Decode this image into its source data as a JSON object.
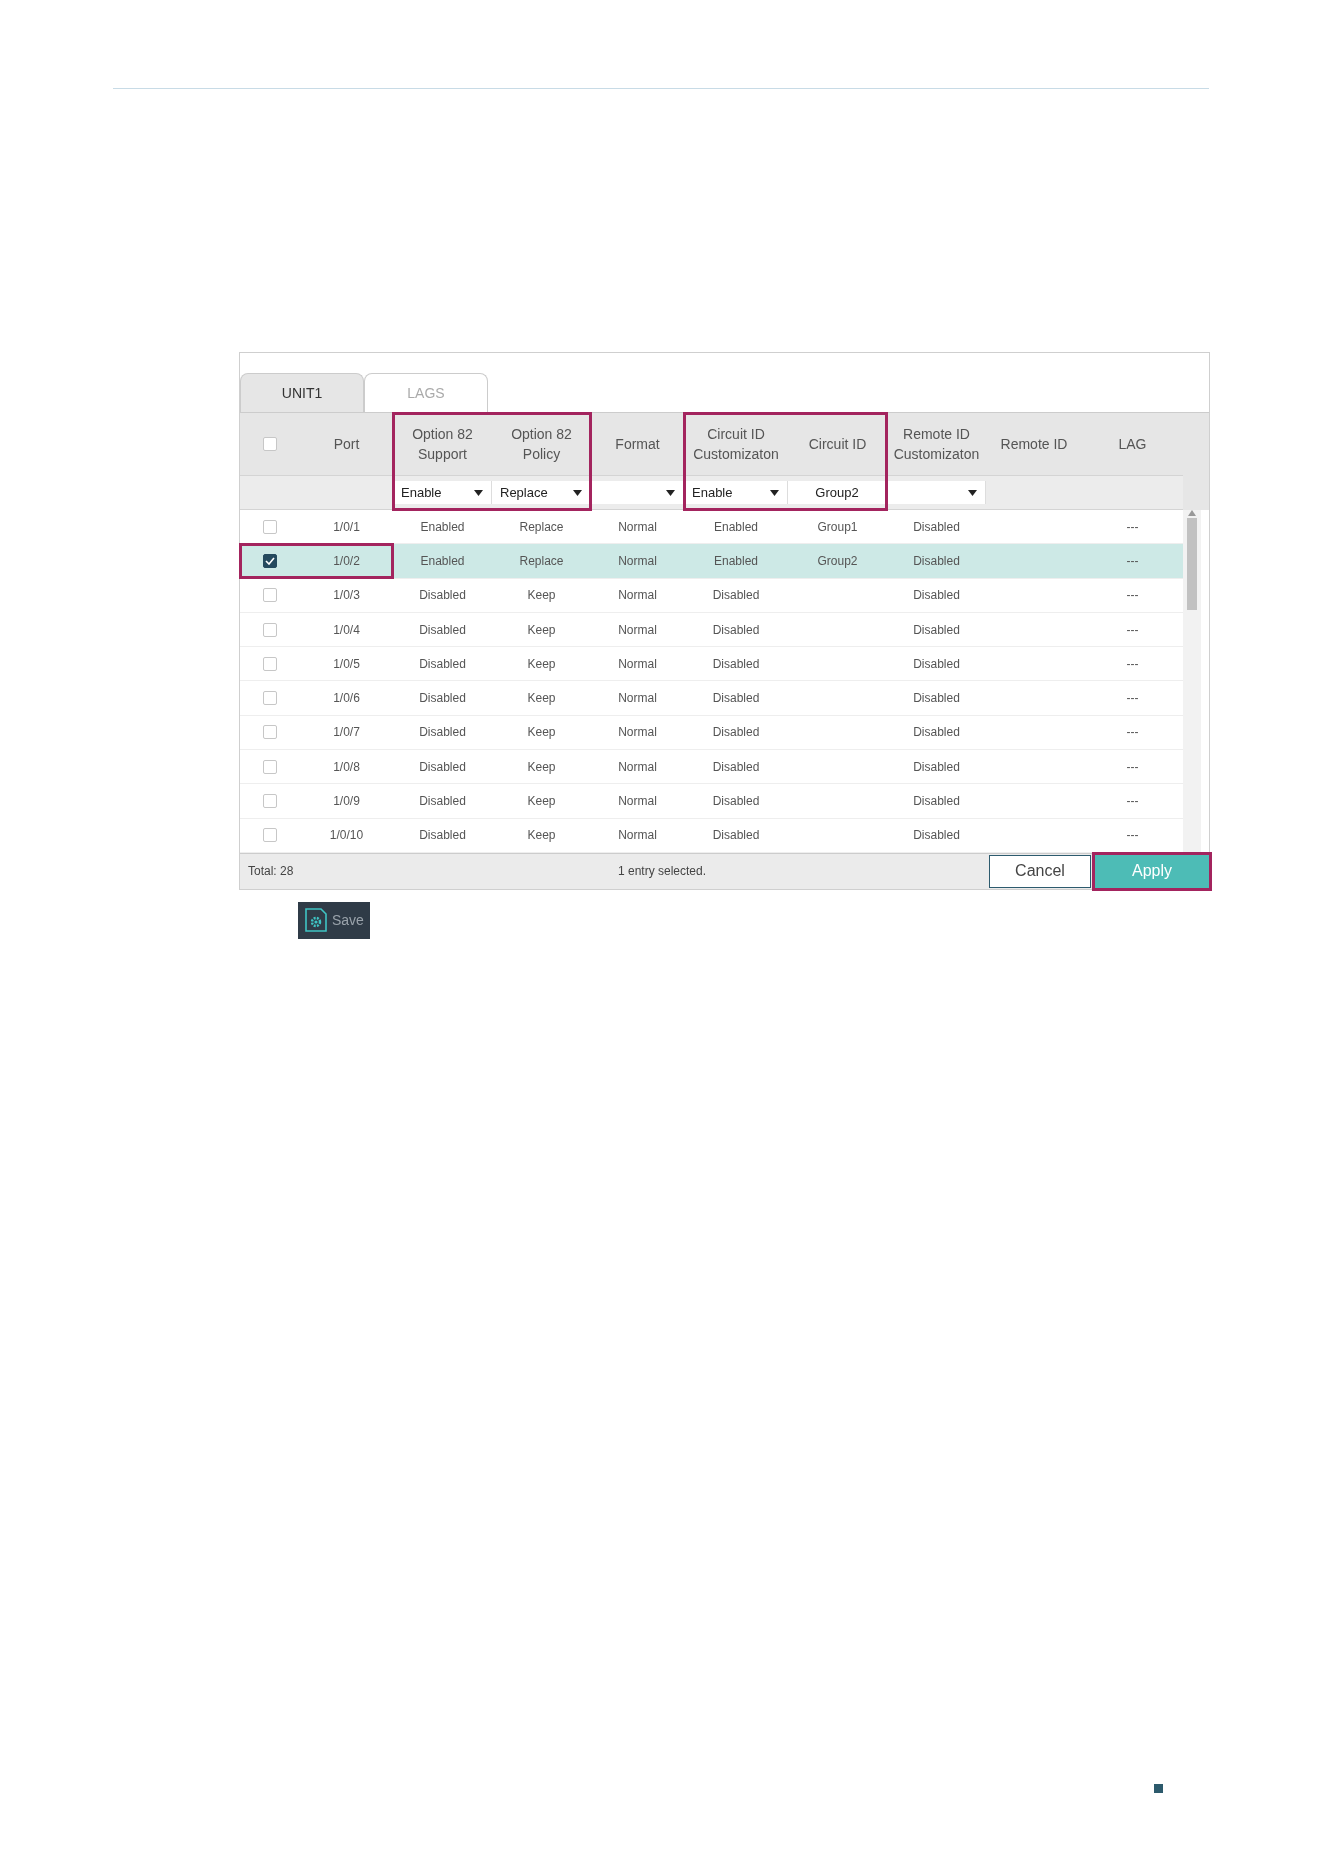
{
  "tabs": [
    {
      "label": "UNIT1",
      "selected": true
    },
    {
      "label": "LAGS",
      "selected": false
    }
  ],
  "table": {
    "select_all": {
      "checked": false
    },
    "column_groups": [
      {
        "highlighted": false,
        "columns": [
          {
            "label": "Port",
            "filter": {
              "kind": "none"
            }
          }
        ]
      },
      {
        "highlighted": true,
        "columns": [
          {
            "label": "Option 82 Support",
            "filter": {
              "kind": "select",
              "value": "Enable"
            }
          },
          {
            "label": "Option 82 Policy",
            "filter": {
              "kind": "select",
              "value": "Replace"
            }
          }
        ]
      },
      {
        "highlighted": false,
        "columns": [
          {
            "label": "Format",
            "filter": {
              "kind": "select"
            }
          }
        ]
      },
      {
        "highlighted": true,
        "columns": [
          {
            "label": "Circuit ID Customizaton",
            "filter": {
              "kind": "select",
              "value": "Enable"
            }
          },
          {
            "label": "Circuit ID",
            "filter": {
              "kind": "input",
              "value": "Group2"
            }
          }
        ]
      },
      {
        "highlighted": false,
        "columns": [
          {
            "label": "Remote ID Customizaton",
            "filter": {
              "kind": "select"
            }
          },
          {
            "label": "Remote ID",
            "filter": {
              "kind": "none"
            }
          },
          {
            "label": "LAG",
            "filter": {
              "kind": "none"
            }
          }
        ]
      }
    ],
    "rows": [
      {
        "checked": false,
        "selected": false,
        "highlighted": false,
        "cells": [
          "1/0/1",
          "Enabled",
          "Replace",
          "Normal",
          "Enabled",
          "Group1",
          "Disabled",
          "",
          "---"
        ]
      },
      {
        "checked": true,
        "selected": true,
        "highlighted": true,
        "cells": [
          "1/0/2",
          "Enabled",
          "Replace",
          "Normal",
          "Enabled",
          "Group2",
          "Disabled",
          "",
          "---"
        ]
      },
      {
        "checked": false,
        "selected": false,
        "highlighted": false,
        "cells": [
          "1/0/3",
          "Disabled",
          "Keep",
          "Normal",
          "Disabled",
          "",
          "Disabled",
          "",
          "---"
        ]
      },
      {
        "checked": false,
        "selected": false,
        "highlighted": false,
        "cells": [
          "1/0/4",
          "Disabled",
          "Keep",
          "Normal",
          "Disabled",
          "",
          "Disabled",
          "",
          "---"
        ]
      },
      {
        "checked": false,
        "selected": false,
        "highlighted": false,
        "cells": [
          "1/0/5",
          "Disabled",
          "Keep",
          "Normal",
          "Disabled",
          "",
          "Disabled",
          "",
          "---"
        ]
      },
      {
        "checked": false,
        "selected": false,
        "highlighted": false,
        "cells": [
          "1/0/6",
          "Disabled",
          "Keep",
          "Normal",
          "Disabled",
          "",
          "Disabled",
          "",
          "---"
        ]
      },
      {
        "checked": false,
        "selected": false,
        "highlighted": false,
        "cells": [
          "1/0/7",
          "Disabled",
          "Keep",
          "Normal",
          "Disabled",
          "",
          "Disabled",
          "",
          "---"
        ]
      },
      {
        "checked": false,
        "selected": false,
        "highlighted": false,
        "cells": [
          "1/0/8",
          "Disabled",
          "Keep",
          "Normal",
          "Disabled",
          "",
          "Disabled",
          "",
          "---"
        ]
      },
      {
        "checked": false,
        "selected": false,
        "highlighted": false,
        "cells": [
          "1/0/9",
          "Disabled",
          "Keep",
          "Normal",
          "Disabled",
          "",
          "Disabled",
          "",
          "---"
        ]
      },
      {
        "checked": false,
        "selected": false,
        "highlighted": false,
        "cells": [
          "1/0/10",
          "Disabled",
          "Keep",
          "Normal",
          "Disabled",
          "",
          "Disabled",
          "",
          "---"
        ]
      }
    ],
    "total": "Total: 28",
    "selection_note": "1 entry selected."
  },
  "buttons": [
    {
      "label": "Cancel",
      "kind": "secondary",
      "highlighted": false
    },
    {
      "label": "Apply",
      "kind": "primary",
      "highlighted": true
    }
  ],
  "save_button": {
    "label": "Save"
  }
}
